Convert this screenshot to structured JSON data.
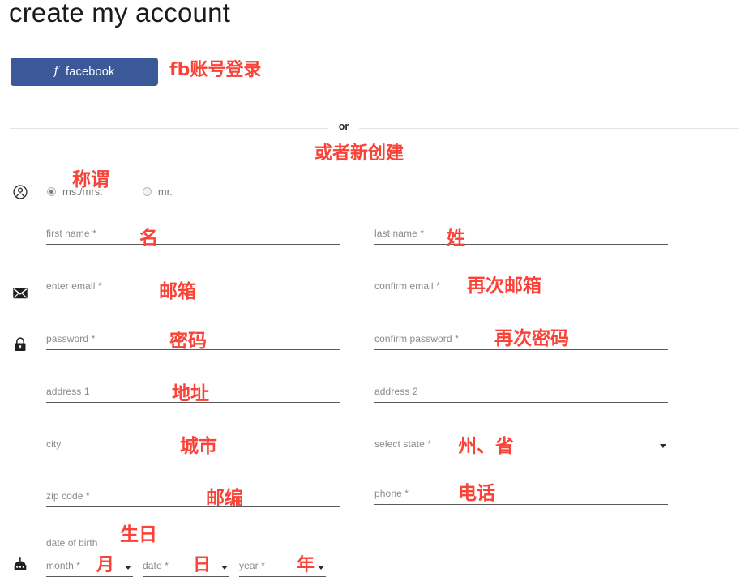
{
  "page": {
    "title": "create my account",
    "accent_red": "#fa4338",
    "facebook_blue": "#3b5998"
  },
  "social": {
    "facebook_label": "facebook",
    "facebook_icon": "facebook-f-icon",
    "annotation": "fb账号登录"
  },
  "divider": {
    "or_label": "or",
    "annotation": "或者新创建"
  },
  "salutation": {
    "icon": "user-circle-icon",
    "annotation": "称谓",
    "options": [
      {
        "label": "ms./mrs.",
        "selected": true
      },
      {
        "label": "mr.",
        "selected": false
      }
    ]
  },
  "fields": {
    "first_name": {
      "label": "first name *",
      "annotation": "名"
    },
    "last_name": {
      "label": "last name *",
      "annotation": "姓"
    },
    "enter_email": {
      "label": "enter email *",
      "annotation": "邮箱",
      "icon": "envelope-icon"
    },
    "confirm_email": {
      "label": "confirm email *",
      "annotation": "再次邮箱"
    },
    "password": {
      "label": "password *",
      "annotation": "密码",
      "icon": "lock-icon"
    },
    "confirm_password": {
      "label": "confirm password *",
      "annotation": "再次密码"
    },
    "address1": {
      "label": "address 1",
      "annotation": "地址"
    },
    "address2": {
      "label": "address 2",
      "annotation": ""
    },
    "city": {
      "label": "city",
      "annotation": "城市"
    },
    "select_state": {
      "label": "select state *",
      "annotation": "州、省"
    },
    "zip_code": {
      "label": "zip code *",
      "annotation": "邮编"
    },
    "phone": {
      "label": "phone *",
      "annotation": "电话"
    }
  },
  "date_of_birth": {
    "title": "date of birth",
    "annotation": "生日",
    "icon": "birthday-cake-icon",
    "month": {
      "label": "month *",
      "annotation": "月"
    },
    "date": {
      "label": "date *",
      "annotation": "日"
    },
    "year": {
      "label": "year *",
      "annotation": "年"
    }
  }
}
